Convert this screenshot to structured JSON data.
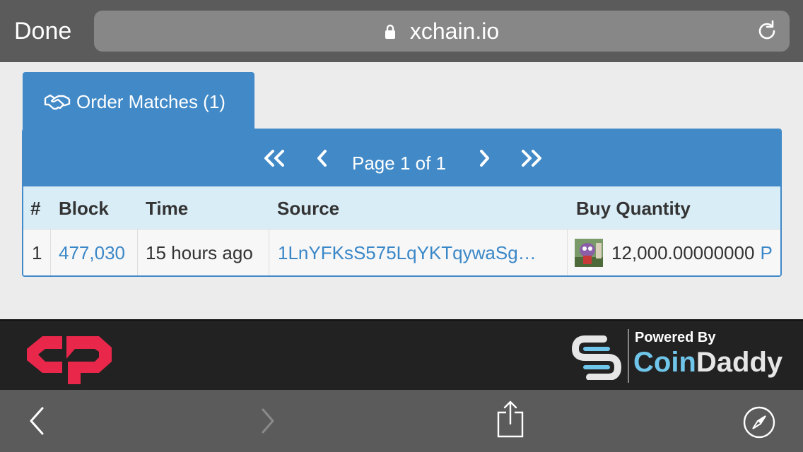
{
  "browser": {
    "done_label": "Done",
    "url": "xchain.io",
    "icons": [
      "lock-icon",
      "reload-icon",
      "back-icon",
      "forward-icon",
      "share-icon",
      "compass-icon"
    ]
  },
  "tab": {
    "icon": "handshake-icon",
    "label": "Order Matches (1)"
  },
  "pagination": {
    "page_text": "Page 1 of 1",
    "icons": [
      "first-page-icon",
      "prev-page-icon",
      "next-page-icon",
      "last-page-icon"
    ]
  },
  "table": {
    "columns": [
      "#",
      "Block",
      "Time",
      "Source",
      "Buy Quantity"
    ],
    "rows": [
      {
        "num": "1",
        "block": "477,030",
        "time": "15 hours ago",
        "source": "1LnYFKsS575LqYKTqywaSg…",
        "buy_quantity": "12,000.00000000",
        "buy_asset_partial": "P"
      }
    ]
  },
  "footer": {
    "powered_by": "Powered By",
    "brand_coin": "Coin",
    "brand_daddy": "Daddy",
    "colors": {
      "counterparty_red": "#e8274b",
      "coindaddy_blue": "#6fc6ea"
    }
  },
  "colors": {
    "accent": "#4189c7",
    "table_header_bg": "#d9edf7",
    "link": "#3a87c8"
  }
}
